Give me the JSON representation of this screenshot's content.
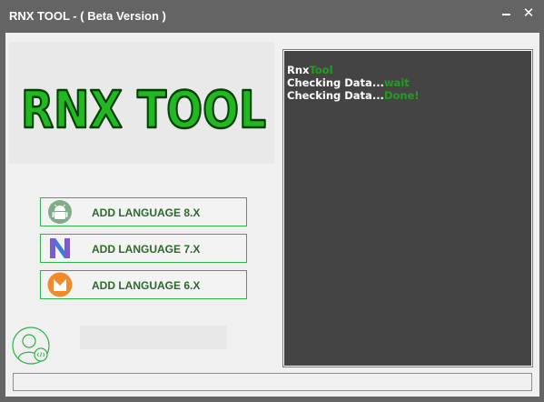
{
  "window": {
    "title": "RNX TOOL - ( Beta Version )",
    "minimize_label": "",
    "close_glyph": "✕"
  },
  "logo": {
    "text": "RNX TOOL",
    "fill_color": "#22b822",
    "outline_color": "#0a3d0a"
  },
  "buttons": [
    {
      "label": "ADD LANGUAGE 8.X",
      "icon": "android-oreo-icon"
    },
    {
      "label": "ADD LANGUAGE 7.X",
      "icon": "android-nougat-icon"
    },
    {
      "label": "ADD LANGUAGE 6.X",
      "icon": "android-marshmallow-icon"
    }
  ],
  "console": {
    "lines": [
      {
        "text": "Rnx",
        "status": "Tool"
      },
      {
        "text": "Checking Data...",
        "status": "wait"
      },
      {
        "text": "Checking Data...",
        "status": "Done!"
      }
    ],
    "text_color": "#ffffff",
    "status_color": "#1aa31a"
  },
  "colors": {
    "accent": "#2fb24a",
    "background": "#f0f0f0",
    "frame": "#646464"
  }
}
